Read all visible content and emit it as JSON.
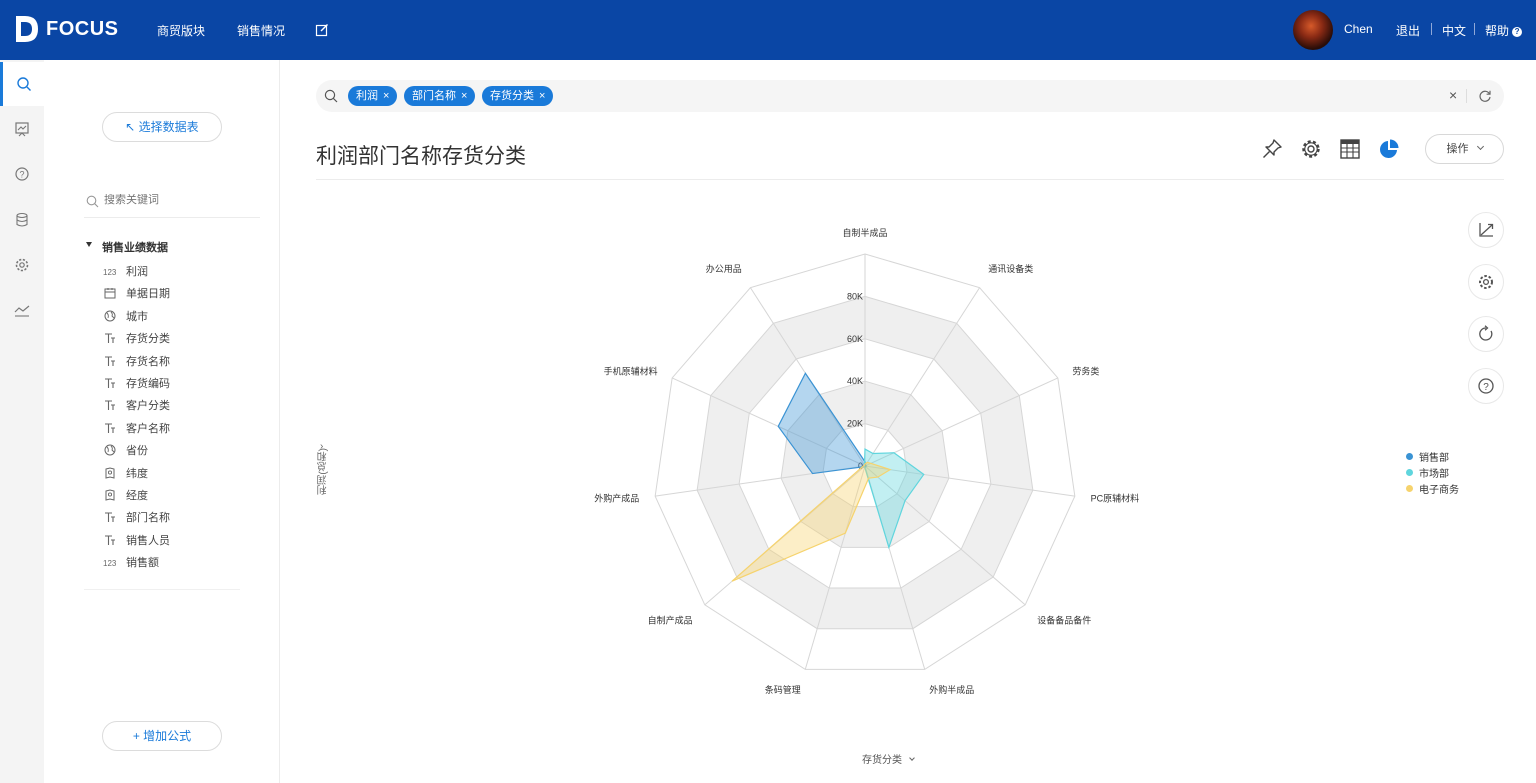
{
  "app": {
    "logo_text": "FOCUS",
    "nav": [
      "商贸版块",
      "销售情况"
    ],
    "user_name": "Chen",
    "logout": "退出",
    "language": "中文",
    "help": "帮助",
    "help_mark": "?"
  },
  "rail": {
    "icons": [
      "search-icon",
      "dashboard-icon",
      "help-icon",
      "database-icon",
      "settings-icon",
      "trend-icon"
    ]
  },
  "panel": {
    "select_table_label": "↖ 选择数据表",
    "search_placeholder": "搜索关键词",
    "tree_title": "销售业绩数据",
    "fields": [
      {
        "label": "利润",
        "type": "number"
      },
      {
        "label": "单据日期",
        "type": "date"
      },
      {
        "label": "城市",
        "type": "geo"
      },
      {
        "label": "存货分类",
        "type": "text"
      },
      {
        "label": "存货名称",
        "type": "text"
      },
      {
        "label": "存货编码",
        "type": "text"
      },
      {
        "label": "客户分类",
        "type": "text"
      },
      {
        "label": "客户名称",
        "type": "text"
      },
      {
        "label": "省份",
        "type": "geo"
      },
      {
        "label": "纬度",
        "type": "coord"
      },
      {
        "label": "经度",
        "type": "coord"
      },
      {
        "label": "部门名称",
        "type": "text"
      },
      {
        "label": "销售人员",
        "type": "text"
      },
      {
        "label": "销售额",
        "type": "number"
      }
    ],
    "add_formula_label": "+ 增加公式"
  },
  "search": {
    "tokens": [
      "利润",
      "部门名称",
      "存货分类"
    ],
    "token_close": "×",
    "clear": "×"
  },
  "chart_header": {
    "title": "利润部门名称存货分类",
    "operate_label": "操作"
  },
  "colors": {
    "brand": "#0a46a5",
    "accent": "#1a7ad9",
    "series": [
      "#3a93d4",
      "#5fd5dd",
      "#f6d36d"
    ]
  },
  "chart_data": {
    "type": "radar",
    "categories": [
      "自制半成品",
      "通讯设备类",
      "劳务类",
      "PC原辅材料",
      "设备备品备件",
      "外购半成品",
      "条码管理",
      "自制产成品",
      "外购产成品",
      "手机原辅材料",
      "办公用品"
    ],
    "radial_ticks": [
      "0",
      "20K",
      "40K",
      "60K",
      "80K"
    ],
    "max": 100000,
    "series": [
      {
        "name": "销售部",
        "values": [
          2000,
          500,
          500,
          500,
          500,
          500,
          500,
          500,
          25000,
          45000,
          52000
        ]
      },
      {
        "name": "市场部",
        "values": [
          8000,
          7000,
          15000,
          28000,
          25000,
          40000,
          500,
          500,
          500,
          500,
          500
        ]
      },
      {
        "name": "电子商务",
        "values": [
          1000,
          2000,
          3000,
          12000,
          8000,
          6000,
          33000,
          83000,
          1000,
          500,
          500
        ]
      }
    ],
    "xlabel": "存货分类",
    "ylabel": "利润(总和)",
    "legend_position": "right"
  }
}
